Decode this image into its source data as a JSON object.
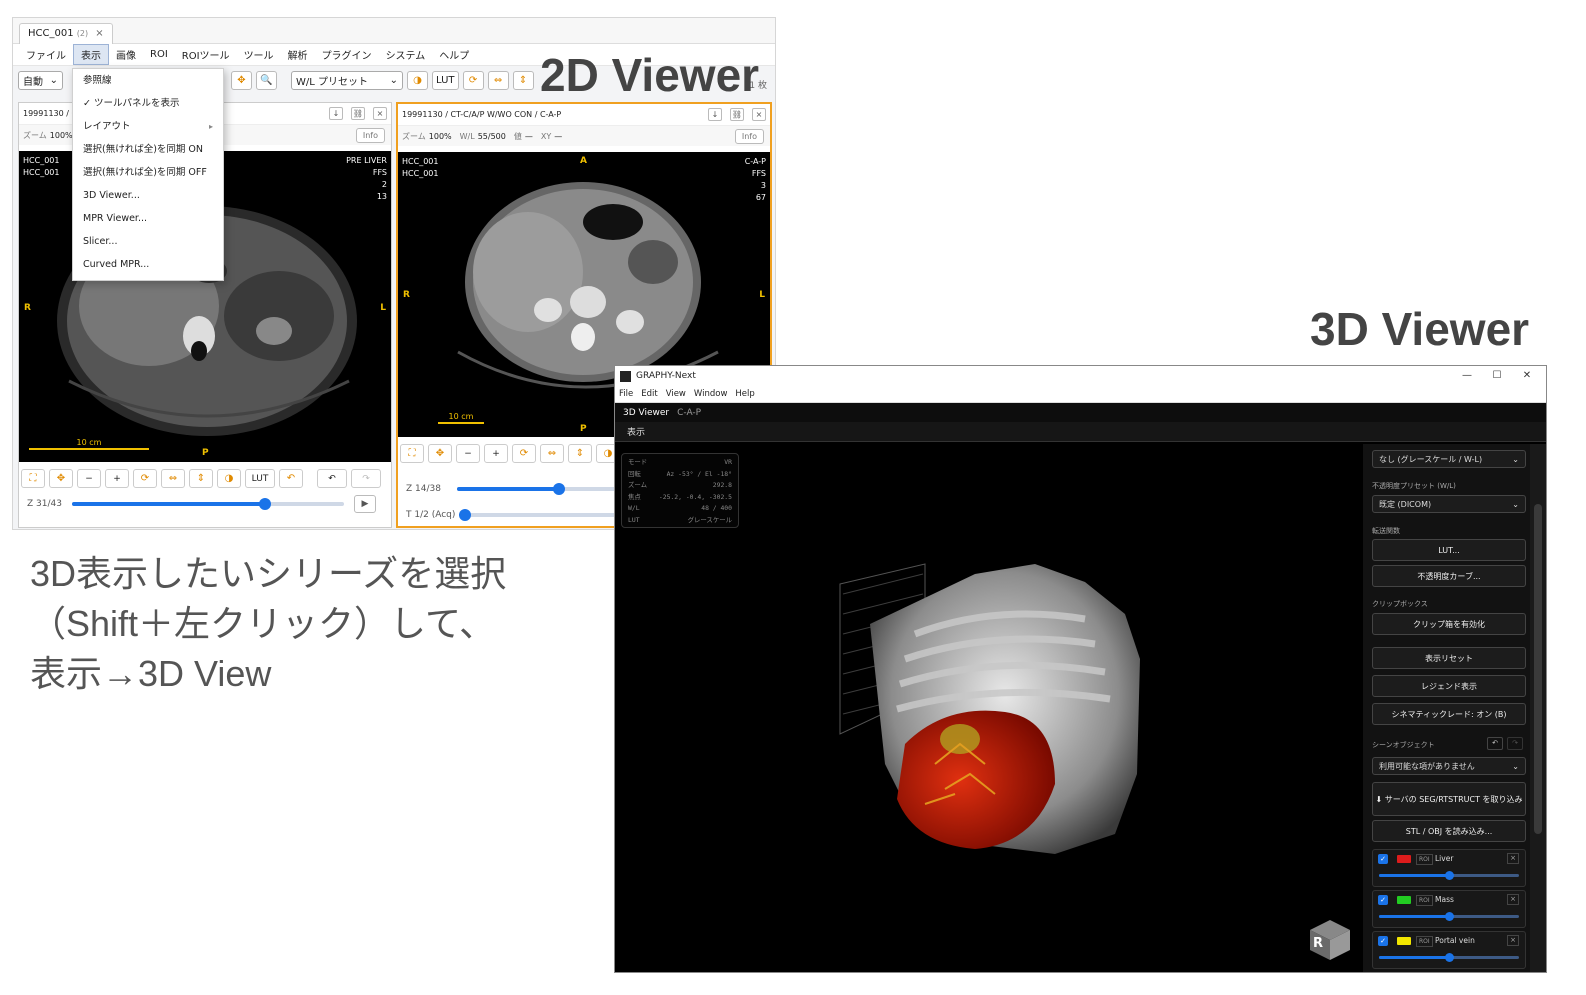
{
  "labels": {
    "viewer2d": "2D Viewer",
    "viewer3d": "3D Viewer",
    "note_lines": [
      "3D表示したいシリーズを選択",
      "（Shift＋左クリック）して、",
      "表示→3D View"
    ]
  },
  "viewer2d": {
    "tab": {
      "name": "HCC_001",
      "count": "(2)",
      "close": "×"
    },
    "menu": [
      "ファイル",
      "表示",
      "画像",
      "ROI",
      "ROIツール",
      "ツール",
      "解析",
      "プラグイン",
      "システム",
      "ヘルプ"
    ],
    "active_menu": "表示",
    "toolbar": {
      "mode_select": "自動",
      "wl_preset": "W/L プリセット",
      "lut": "LUT",
      "right_text": "1 枚"
    },
    "dropdown": [
      {
        "label": "参照線"
      },
      {
        "label": "✓ ツールパネルを表示"
      },
      {
        "label": "レイアウト",
        "arrow": "▸"
      },
      {
        "label": "選択(無ければ全)を同期 ON"
      },
      {
        "label": "選択(無ければ全)を同期 OFF"
      },
      {
        "label": "3D Viewer..."
      },
      {
        "label": "MPR Viewer..."
      },
      {
        "label": "Slicer..."
      },
      {
        "label": "Curved MPR..."
      }
    ],
    "left_pane": {
      "header": "19991130 / C",
      "zoom_label": "ズーム",
      "zoom_value": "100%",
      "info": "Info",
      "ovl_tl": [
        "HCC_001",
        "HCC_001"
      ],
      "ovl_tr": [
        "PRE LIVER",
        "FFS",
        "2",
        "13"
      ],
      "orient": {
        "left": "R",
        "right": "L",
        "bottom": "P"
      },
      "scale": "10 cm",
      "ctrl_lut": "LUT",
      "slider_label": "Z 31/43",
      "slider_value": 0.71
    },
    "right_pane": {
      "header": "19991130 / CT-C/A/P W/WO CON / C-A-P",
      "zoom_label": "ズーム",
      "zoom_value": "100%",
      "wl_label": "W/L",
      "wl_value": "55/500",
      "val_label": "値",
      "val_value": "—",
      "xy_label": "XY",
      "xy_value": "—",
      "info": "Info",
      "ovl_tl": [
        "HCC_001",
        "HCC_001"
      ],
      "ovl_tr": [
        "C-A-P",
        "FFS",
        "3",
        "67"
      ],
      "orient": {
        "top": "A",
        "left": "R",
        "right": "L",
        "bottom": "P"
      },
      "scale": "10 cm",
      "slider1_label": "Z 14/38",
      "slider1_value": 0.34,
      "slider2_label": "T 1/2 (Acq)",
      "slider2_value": 0.0
    }
  },
  "viewer3d": {
    "title": "GRAPHY-Next",
    "window_controls": [
      "—",
      "☐",
      "✕"
    ],
    "menu": [
      "File",
      "Edit",
      "View",
      "Window",
      "Help"
    ],
    "header_title": "3D Viewer",
    "header_sub": "C-A-P",
    "tab": "表示",
    "info": [
      [
        "モード",
        "VR"
      ],
      [
        "回転",
        "Az -53°  /  El -18°"
      ],
      [
        "ズーム",
        "292.8"
      ],
      [
        "焦点",
        "-25.2, -0.4, -302.5"
      ],
      [
        "W/L",
        "48 / 400"
      ],
      [
        "LUT",
        "グレースケール"
      ]
    ],
    "panel": {
      "lut_select": "なし (グレースケール / W-L)",
      "opacity_preset_label": "不透明度プリセット (W/L)",
      "opacity_preset": "既定 (DICOM)",
      "transfer_label": "転送関数",
      "lut_btn": "LUT...",
      "opacity_curve_btn": "不透明度カーブ...",
      "clip_label": "クリップボックス",
      "clip_btn": "クリップ箱を有効化",
      "reset_btn": "表示リセット",
      "legend_btn": "レジェンド表示",
      "cinematic_btn": "シネマティックレード: オン (B)",
      "scene_label": "シーンオブジェクト",
      "scene_select": "利用可能な項がありません",
      "seg_btn": "⬇ サーバの SEG/RTSTRUCT を取り込み",
      "stl_btn": "STL / OBJ を読み込み...",
      "rois": [
        {
          "name": "Liver",
          "tag": "ROI",
          "color": "#dd1c1c",
          "opacity": 0.5,
          "checked": "✓",
          "close": "×"
        },
        {
          "name": "Mass",
          "tag": "ROI",
          "color": "#22cc22",
          "opacity": 0.5,
          "checked": "✓",
          "close": "×"
        },
        {
          "name": "Portal vein",
          "tag": "ROI",
          "color": "#f2e600",
          "opacity": 0.5,
          "checked": "✓",
          "close": "×"
        }
      ]
    },
    "cube_label": "R"
  }
}
